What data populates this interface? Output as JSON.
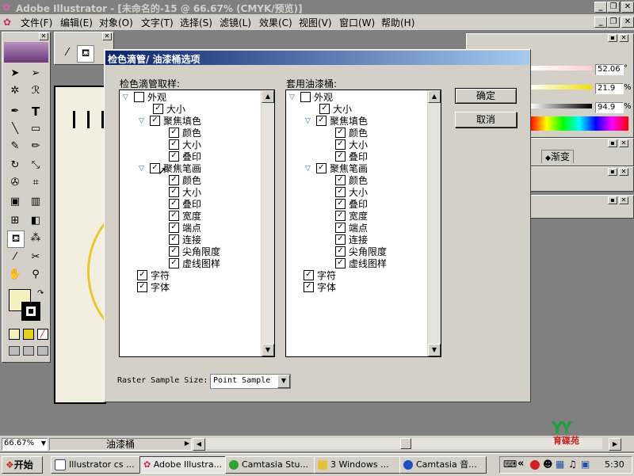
{
  "app": {
    "title": "Adobe Illustrator - [未命名的-15 @ 66.67% (CMYK/预览)]"
  },
  "menu": [
    "文件(F)",
    "编辑(E)",
    "对象(O)",
    "文字(T)",
    "选择(S)",
    "滤镜(L)",
    "效果(C)",
    "视图(V)",
    "窗口(W)",
    "帮助(H)"
  ],
  "dialog": {
    "title": "检色滴管/ 油漆桶选项",
    "left_label": "检色滴管取样:",
    "right_label": "套用油漆桶:",
    "tree": {
      "appearance": "外观",
      "size": "大小",
      "fill": "聚焦填色",
      "color": "颜色",
      "overprint": "叠印",
      "stroke": "聚焦笔画",
      "weight": "宽度",
      "cap": "端点",
      "join": "连接",
      "miter": "尖角限度",
      "dash": "虚线图样",
      "character": "字符",
      "paragraph": "字体"
    },
    "ok_label": "确定",
    "cancel_label": "取消",
    "raster_label": "Raster Sample Size:",
    "raster_value": "Point Sample"
  },
  "color_panel": {
    "v1": "52.06",
    "v2": "21.9",
    "v3": "94.9",
    "unit_deg": "°",
    "unit_pct": "%"
  },
  "gradient_tab": "渐变",
  "status": {
    "zoom": "66.67%",
    "tool": "油漆桶"
  },
  "watermark": "育碟苑",
  "taskbar": {
    "start": "开始",
    "tasks": [
      "Illustrator cs ...",
      "Adobe Illustra...",
      "Camtasia Stu...",
      "3 Windows ...",
      "Camtasia 音..."
    ],
    "clock": "5:30"
  }
}
